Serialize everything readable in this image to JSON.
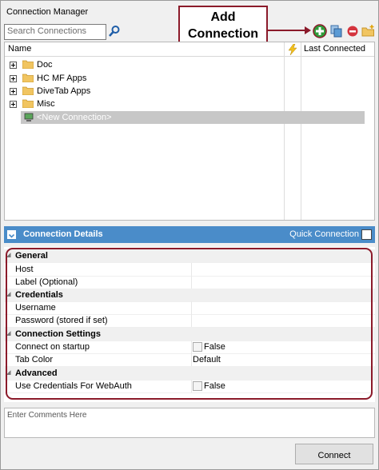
{
  "window": {
    "title": "Connection Manager"
  },
  "search": {
    "placeholder": "Search Connections"
  },
  "callout": {
    "line1": "Add",
    "line2": "Connection"
  },
  "tree": {
    "columns": {
      "name": "Name",
      "last_connected": "Last Connected"
    },
    "items": [
      {
        "label": "Doc"
      },
      {
        "label": "HC MF Apps"
      },
      {
        "label": "DiveTab Apps"
      },
      {
        "label": "Misc"
      }
    ],
    "new_connection": "<New Connection>"
  },
  "details": {
    "title": "Connection Details",
    "quick_connection": "Quick Connection",
    "groups": [
      {
        "label": "General",
        "rows": [
          {
            "name": "Host",
            "value": ""
          },
          {
            "name": "Label (Optional)",
            "value": ""
          }
        ]
      },
      {
        "label": "Credentials",
        "rows": [
          {
            "name": "Username",
            "value": ""
          },
          {
            "name": "Password (stored if set)",
            "value": ""
          }
        ]
      },
      {
        "label": "Connection Settings",
        "rows": [
          {
            "name": "Connect on startup",
            "value": "False"
          },
          {
            "name": "Tab Color",
            "value": "Default"
          }
        ]
      },
      {
        "label": "Advanced",
        "rows": [
          {
            "name": "Use Credentials For WebAuth",
            "value": "False"
          }
        ]
      }
    ]
  },
  "comments": {
    "placeholder": "Enter Comments Here"
  },
  "buttons": {
    "connect": "Connect"
  },
  "icons": {
    "search": "search-icon",
    "add": "add-connection-icon",
    "copy": "duplicate-icon",
    "remove": "remove-icon",
    "new_folder": "new-folder-icon",
    "lightning": "lightning-icon",
    "computer": "computer-icon"
  },
  "colors": {
    "accent_bar": "#4a8cc9",
    "callout_border": "#8b1a2a",
    "add_green": "#2f9b3a",
    "remove_red": "#d4343e"
  }
}
